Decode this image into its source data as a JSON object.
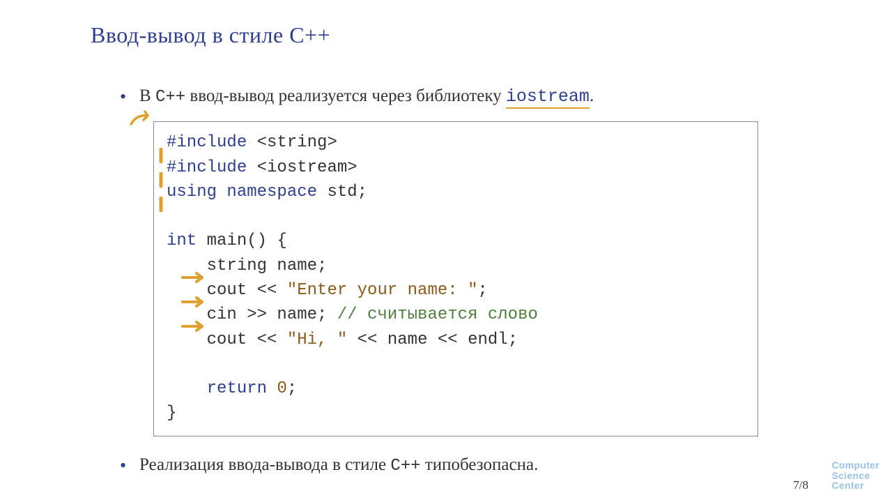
{
  "title": "Ввод-вывод в стиле C++",
  "bullets": {
    "b1_pre": "В ",
    "b1_cxx": "C++",
    "b1_mid": " ввод-вывод реализуется через библиотеку ",
    "b1_lib": "iostream",
    "b1_post": ".",
    "b2_pre": "Реализация ввода-вывода в стиле ",
    "b2_cxx": "C++",
    "b2_post": " типобезопасна."
  },
  "code": {
    "l1_a": "#include",
    "l1_b": " <string>",
    "l2_a": "#include",
    "l2_b": " <iostream>",
    "l3_a": "using",
    "l3_b": " ",
    "l3_c": "namespace",
    "l3_d": " std;",
    "l4": "",
    "l5_a": "int",
    "l5_b": " main() {",
    "l6_a": "    string name;",
    "l7_a": "    cout << ",
    "l7_b": "\"Enter your name: \"",
    "l7_c": ";",
    "l8_a": "    cin >> name; ",
    "l8_b": "// считывается слово",
    "l9_a": "    cout << ",
    "l9_b": "\"Hi, \"",
    "l9_c": " << name << endl;",
    "l10": "",
    "l11_a": "    ",
    "l11_b": "return",
    "l11_c": " ",
    "l11_d": "0",
    "l11_e": ";",
    "l12": "}"
  },
  "page": "7/8",
  "logo": {
    "l1": "Computer",
    "l2": "Science",
    "l3": "Center"
  }
}
